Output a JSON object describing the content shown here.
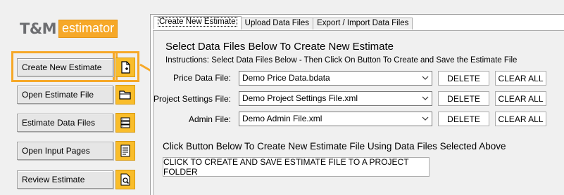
{
  "logo": {
    "brand": "T&M",
    "product": "estimator"
  },
  "sidebar": {
    "items": [
      {
        "label": "Create New Estimate",
        "icon": "new-file-icon"
      },
      {
        "label": "Open Estimate File",
        "icon": "folder-icon"
      },
      {
        "label": "Estimate Data Files",
        "icon": "list-icon"
      },
      {
        "label": "Open Input Pages",
        "icon": "form-icon"
      },
      {
        "label": "Review Estimate",
        "icon": "magnify-document-icon"
      }
    ]
  },
  "tabs": [
    {
      "label": "Create New Estimate",
      "active": true
    },
    {
      "label": "Upload Data Files",
      "active": false
    },
    {
      "label": "Export / Import Data Files",
      "active": false
    }
  ],
  "main": {
    "heading": "Select Data Files Below To Create New Estimate",
    "instructions": "Instructions:  Select Data Files Below - Then Click On Button To Create and Save the Estimate File",
    "rows": [
      {
        "label": "Price Data File:",
        "value": "Demo Price Data.bdata",
        "delete": "DELETE",
        "clear": "CLEAR ALL"
      },
      {
        "label": "Project Settings File:",
        "value": "Demo Project Settings File.xml",
        "delete": "DELETE",
        "clear": "CLEAR ALL"
      },
      {
        "label": "Admin File:",
        "value": "Demo Admin File.xml",
        "delete": "DELETE",
        "clear": "CLEAR ALL"
      }
    ],
    "subheading": "Click Button Below To Create New Estimate File Using Data Files Selected Above",
    "create_button": "CLICK TO CREATE AND SAVE ESTIMATE FILE TO A PROJECT FOLDER"
  },
  "colors": {
    "accent": "#f6a828",
    "icon_bg": "#f9bd2b"
  }
}
